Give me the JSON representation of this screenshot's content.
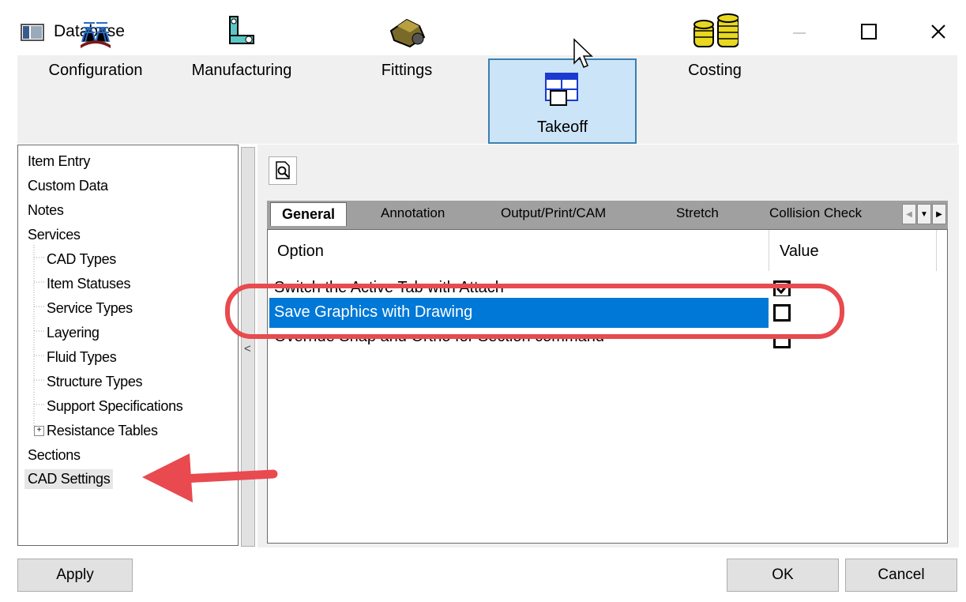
{
  "window": {
    "title": "Database"
  },
  "toolbar": {
    "buttons": [
      {
        "label": "Configuration",
        "icon": "books-icon"
      },
      {
        "label": "Manufacturing",
        "icon": "machine-icon"
      },
      {
        "label": "Fittings",
        "icon": "fitting-icon"
      },
      {
        "label": "Takeoff",
        "icon": "takeoff-icon",
        "active": true
      },
      {
        "label": "Costing",
        "icon": "coins-icon"
      }
    ]
  },
  "tree": {
    "items": [
      {
        "label": "Item Entry"
      },
      {
        "label": "Custom Data"
      },
      {
        "label": "Notes"
      },
      {
        "label": "Services"
      },
      {
        "label": "CAD Types"
      },
      {
        "label": "Item Statuses"
      },
      {
        "label": "Service Types"
      },
      {
        "label": "Layering"
      },
      {
        "label": "Fluid Types"
      },
      {
        "label": "Structure Types"
      },
      {
        "label": "Support Specifications"
      },
      {
        "label": "Resistance Tables"
      },
      {
        "label": "Sections"
      },
      {
        "label": "CAD Settings",
        "selected": true
      }
    ]
  },
  "splitter": {
    "label": "<"
  },
  "tabs": {
    "items": [
      {
        "label": "General",
        "active": true
      },
      {
        "label": "Annotation"
      },
      {
        "label": "Output/Print/CAM"
      },
      {
        "label": "Stretch"
      },
      {
        "label": "Collision Check"
      }
    ]
  },
  "grid": {
    "header": {
      "option": "Option",
      "value": "Value"
    },
    "rows": [
      {
        "option": "Switch the Active Tab with Attach",
        "checked": true
      },
      {
        "option": "Save Graphics with Drawing",
        "checked": false,
        "selected": true
      },
      {
        "option": "Override Snap and Ortho for Section command",
        "checked": false
      }
    ]
  },
  "buttons": {
    "apply": "Apply",
    "ok": "OK",
    "cancel": "Cancel"
  },
  "colors": {
    "selection": "#0078d7",
    "annotation": "#e84a4f",
    "active_tab": "#cce4f7"
  }
}
